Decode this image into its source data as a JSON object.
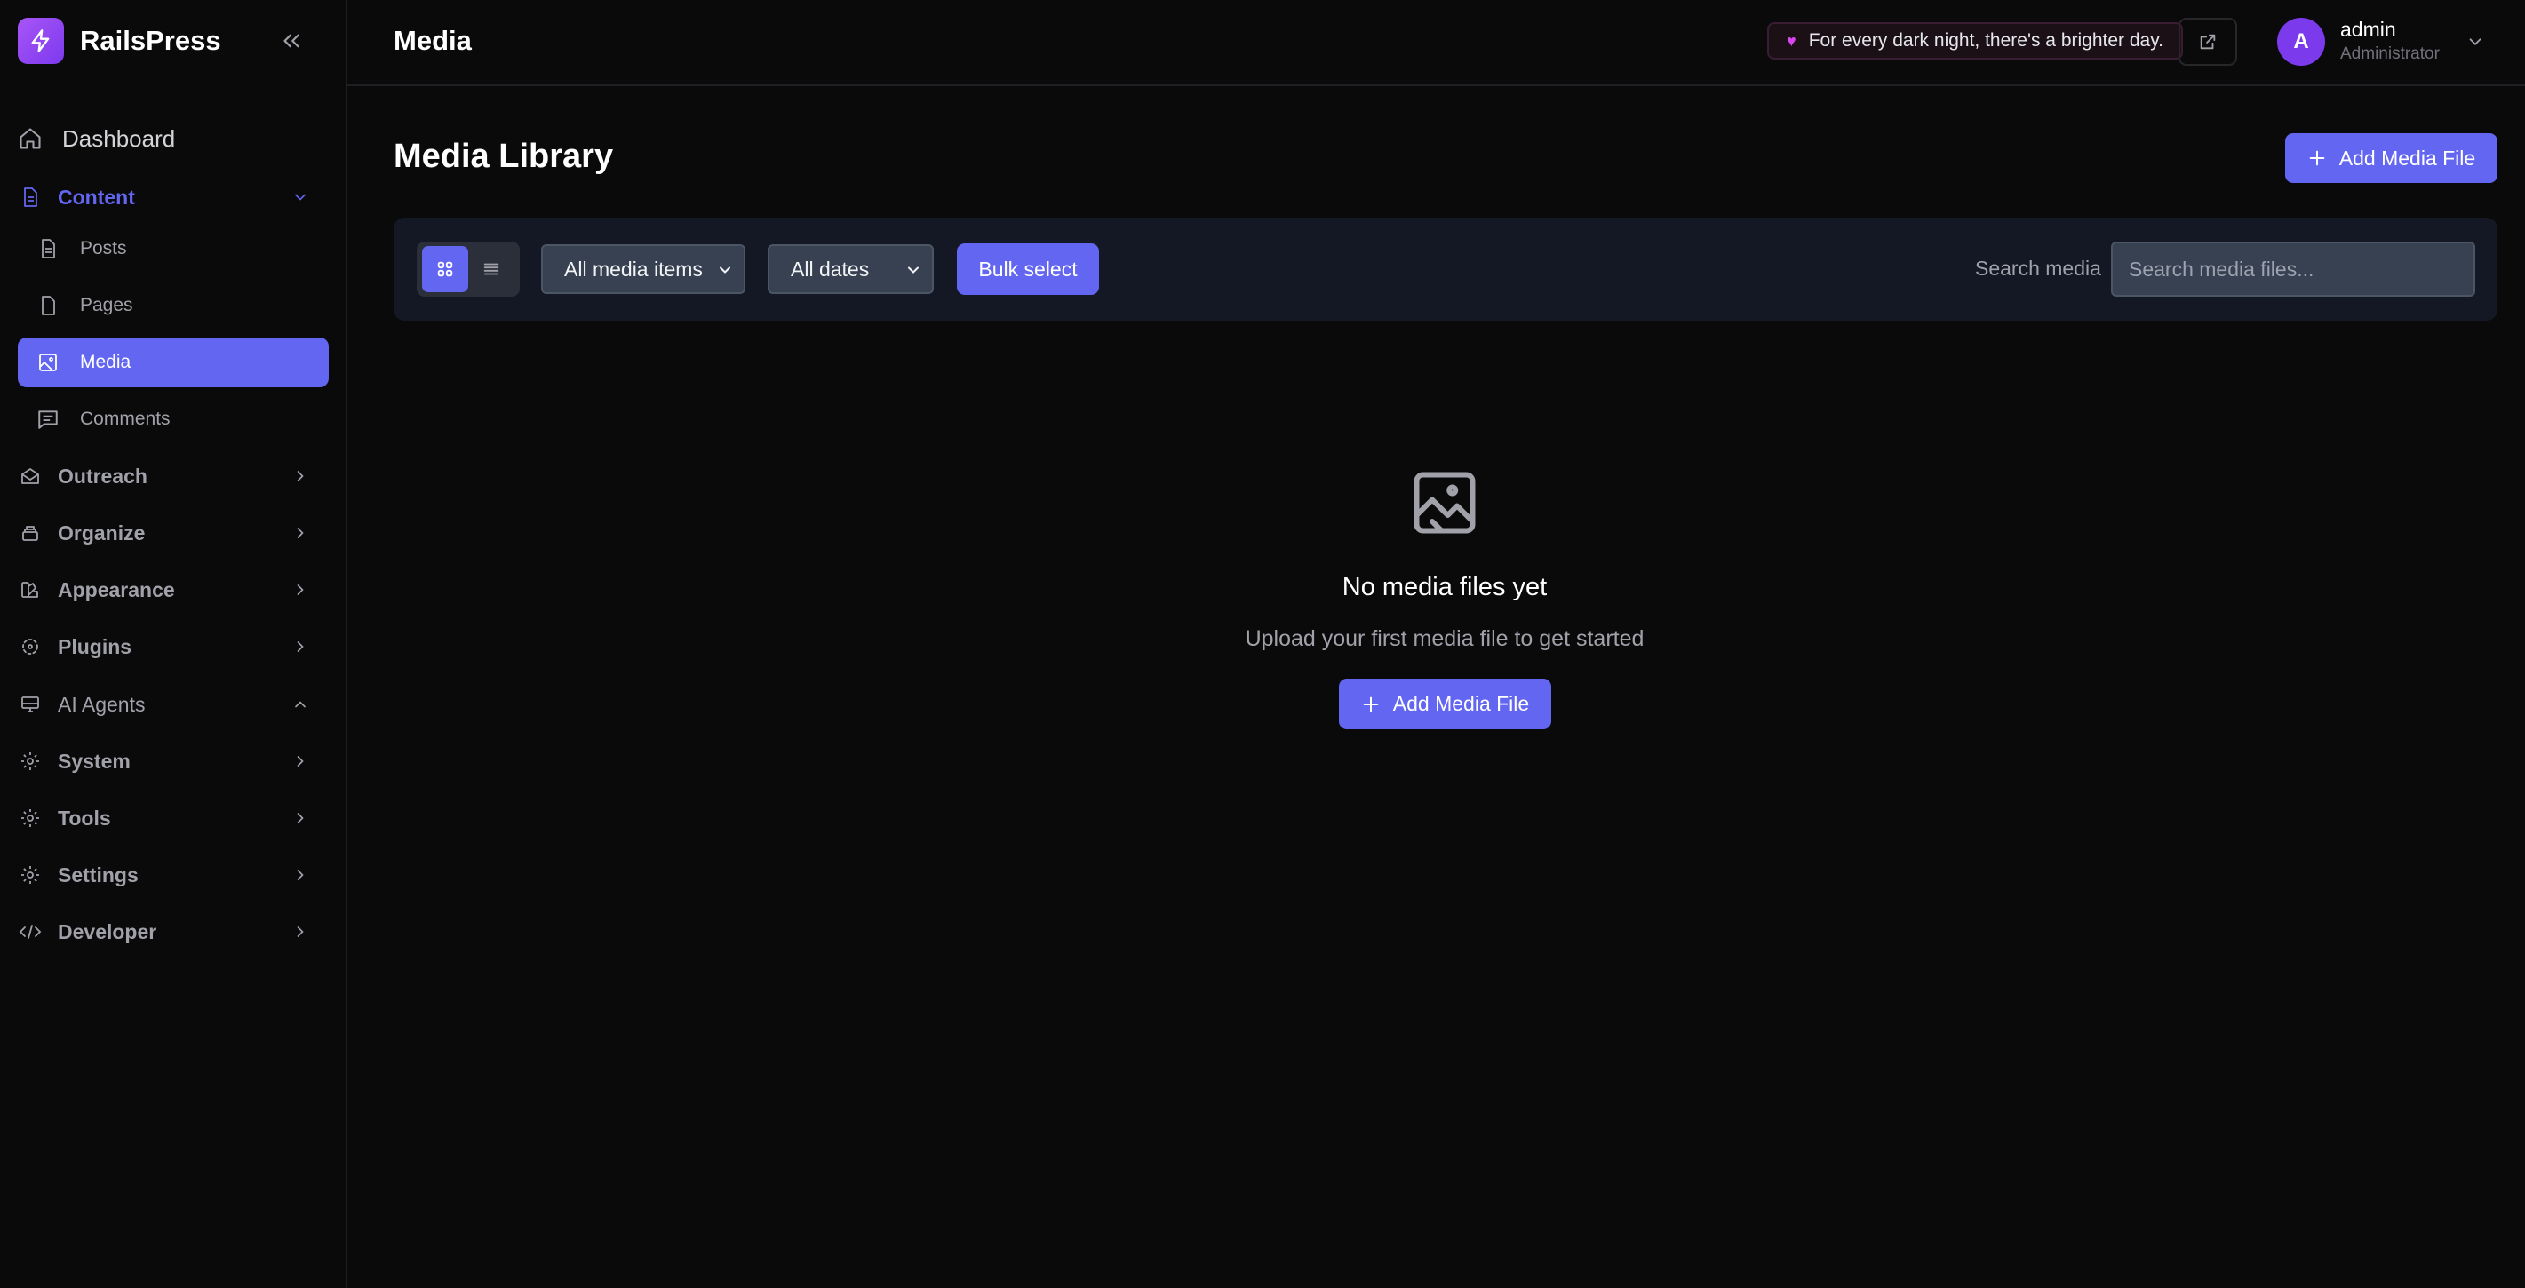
{
  "brand": {
    "name": "RailsPress"
  },
  "header": {
    "title": "Media",
    "quote": "For every dark night, there's a brighter day.",
    "user": {
      "initial": "A",
      "name": "admin",
      "role": "Administrator"
    }
  },
  "sidebar": {
    "dashboard": "Dashboard",
    "content": {
      "label": "Content",
      "items": [
        {
          "label": "Posts"
        },
        {
          "label": "Pages"
        },
        {
          "label": "Media"
        },
        {
          "label": "Comments"
        }
      ]
    },
    "sections": [
      {
        "label": "Outreach"
      },
      {
        "label": "Organize"
      },
      {
        "label": "Appearance"
      },
      {
        "label": "Plugins"
      },
      {
        "label": "AI Agents"
      },
      {
        "label": "System"
      },
      {
        "label": "Tools"
      },
      {
        "label": "Settings"
      },
      {
        "label": "Developer"
      }
    ]
  },
  "main": {
    "title": "Media Library",
    "add_button": "Add Media File",
    "filters": {
      "type_selected": "All media items",
      "date_selected": "All dates",
      "bulk_select": "Bulk select",
      "search_label": "Search media",
      "search_placeholder": "Search media files..."
    },
    "empty": {
      "title": "No media files yet",
      "subtitle": "Upload your first media file to get started",
      "button": "Add Media File"
    }
  },
  "colors": {
    "accent": "#6366f1",
    "brand_gradient_start": "#a855f7",
    "avatar": "#7c3aed",
    "quote_heart": "#d946ef",
    "background": "#0a0a0a",
    "toolbar": "#141824"
  }
}
